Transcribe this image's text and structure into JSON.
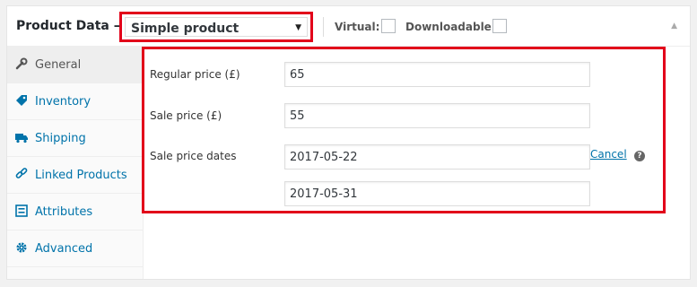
{
  "header": {
    "title": "Product Data —",
    "product_type": "Simple product",
    "virtual_label": "Virtual:",
    "downloadable_label": "Downloadable:"
  },
  "tabs": [
    {
      "label": "General",
      "icon": "wrench-icon",
      "active": true
    },
    {
      "label": "Inventory",
      "icon": "tag-icon",
      "active": false
    },
    {
      "label": "Shipping",
      "icon": "truck-icon",
      "active": false
    },
    {
      "label": "Linked Products",
      "icon": "link-icon",
      "active": false
    },
    {
      "label": "Attributes",
      "icon": "list-icon",
      "active": false
    },
    {
      "label": "Advanced",
      "icon": "gear-icon",
      "active": false
    }
  ],
  "form": {
    "regular_price_label": "Regular price (£)",
    "regular_price_value": "65",
    "sale_price_label": "Sale price (£)",
    "sale_price_value": "55",
    "sale_dates_label": "Sale price dates",
    "sale_date_from": "2017-05-22",
    "sale_date_to": "2017-05-31",
    "cancel_label": "Cancel",
    "help_glyph": "?"
  },
  "colors": {
    "highlight": "#e2001a",
    "link": "#0073aa"
  }
}
